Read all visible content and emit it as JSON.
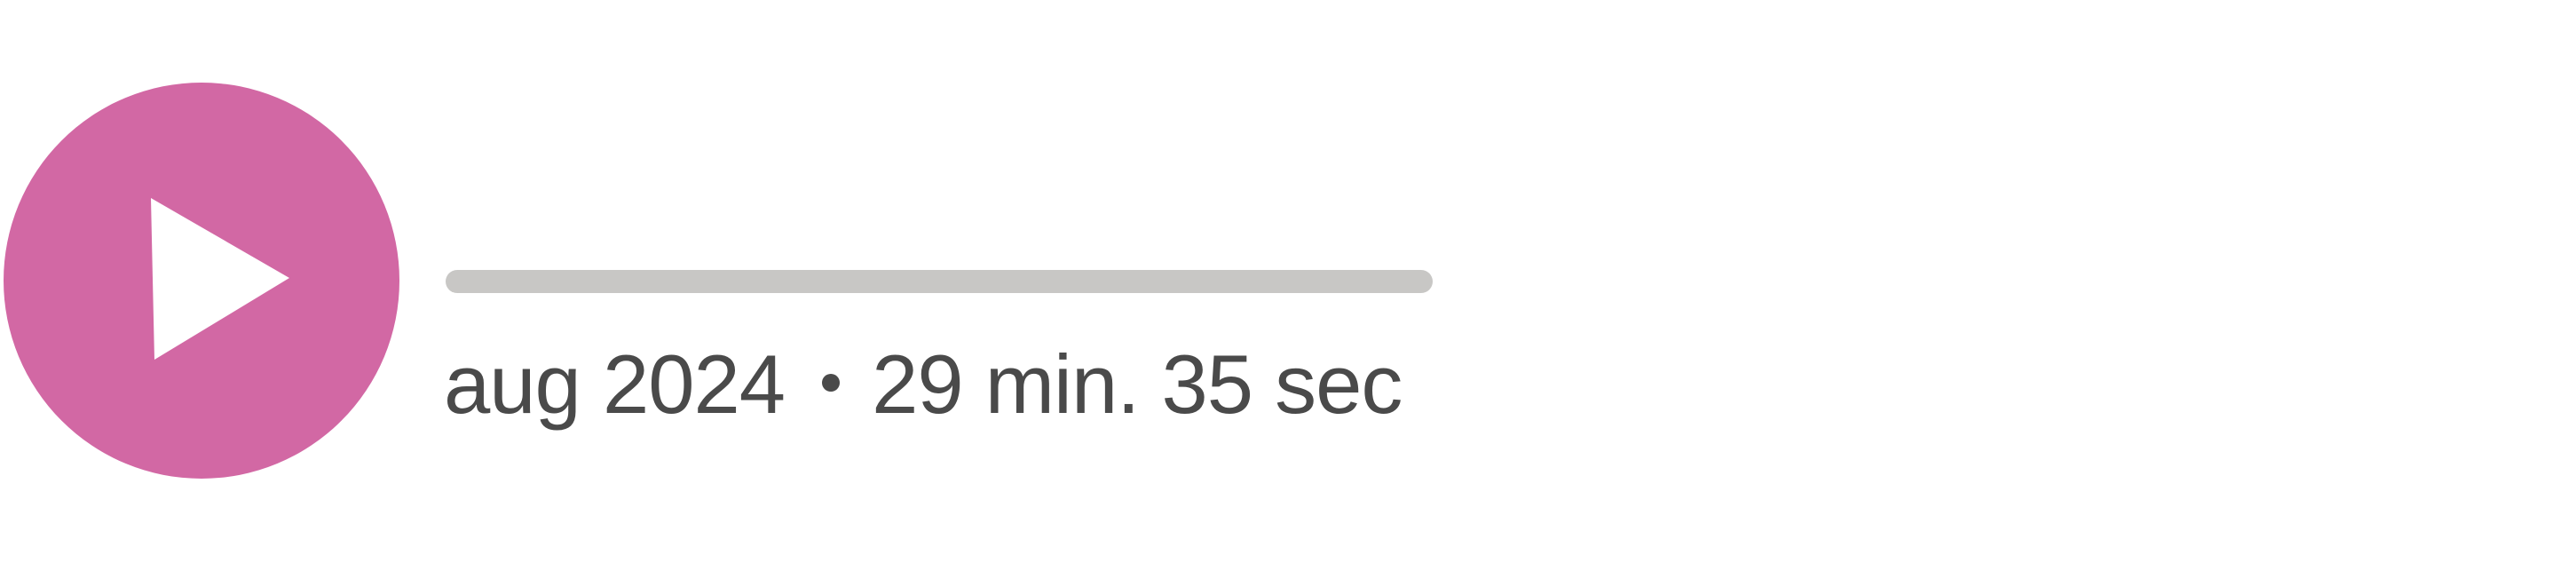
{
  "player": {
    "play_icon": "play-icon",
    "progress": {
      "fraction": 0
    },
    "date": "aug 2024",
    "duration": "29 min. 35 sec",
    "colors": {
      "accent": "#d268a4",
      "track": "#c8c7c5",
      "text": "#4a4a4a"
    }
  }
}
